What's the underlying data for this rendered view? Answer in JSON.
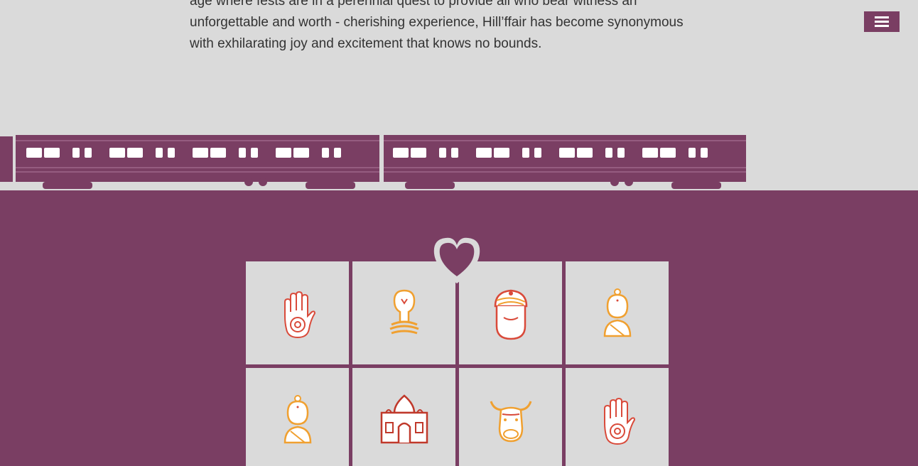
{
  "intro": {
    "line1": "age where fests are in a perennial quest to provide all who bear witness an",
    "line2": "unforgettable and worth - cherishing experience, Hill’ffair has become synonymous",
    "line3": "with exhilarating joy and excitement that knows no bounds."
  },
  "menu": {
    "icon": "hamburger-icon"
  },
  "colors": {
    "accent": "#7a3e63",
    "background": "#dadada",
    "orange": "#f0a030",
    "red": "#c0392b"
  },
  "grid": {
    "tiles": [
      {
        "icon": "hamsa-hand-icon"
      },
      {
        "icon": "snake-lingam-icon"
      },
      {
        "icon": "turban-man-icon"
      },
      {
        "icon": "indian-woman-icon"
      },
      {
        "icon": "indian-woman-icon"
      },
      {
        "icon": "taj-mahal-icon"
      },
      {
        "icon": "cow-icon"
      },
      {
        "icon": "hamsa-hand-icon"
      }
    ],
    "badge": "heart-icon"
  }
}
